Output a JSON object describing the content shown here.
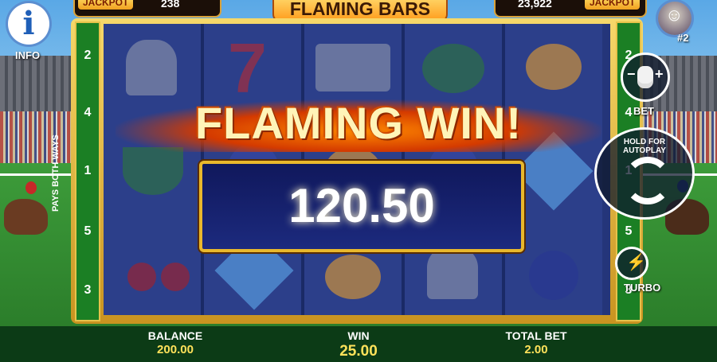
{
  "header": {
    "game_title": "FLAMING BARS",
    "jackpot_left_label": "JACKPOT",
    "jackpot_left_value": "238",
    "jackpot_right_label": "JACKPOT",
    "jackpot_right_value": "23,922",
    "player_rank": "#2"
  },
  "info": {
    "label": "INFO"
  },
  "paylines": {
    "left": [
      "2",
      "4",
      "1",
      "5",
      "3"
    ],
    "right": [
      "2",
      "4",
      "1",
      "5",
      "3"
    ],
    "side_label": "PAYS BOTH WAYS"
  },
  "reels": {
    "symbols": [
      [
        "bell-icon",
        "watermelon-icon",
        "cherry-icon"
      ],
      [
        "seven-icon",
        "plum-icon",
        "diamond-icon"
      ],
      [
        "bars-logo-icon",
        "lemon-icon",
        "lemon-icon"
      ],
      [
        "watermelon-icon",
        "plum-icon",
        "bell-icon"
      ],
      [
        "lemon-icon",
        "diamond-icon",
        "plum-icon"
      ]
    ]
  },
  "win_overlay": {
    "headline": "FLAMING WIN!",
    "amount": "120.50"
  },
  "controls": {
    "bet_label": "BET",
    "autoplay_label": "HOLD FOR AUTOPLAY",
    "turbo_label": "TURBO"
  },
  "footer": {
    "balance_label": "BALANCE",
    "balance_value": "200.00",
    "win_label": "WIN",
    "win_value": "25.00",
    "total_bet_label": "TOTAL BET",
    "total_bet_value": "2.00"
  },
  "colors": {
    "accent_gold": "#e9b82c",
    "win_yellow": "#ffe25a",
    "reel_blue": "#24357a"
  }
}
